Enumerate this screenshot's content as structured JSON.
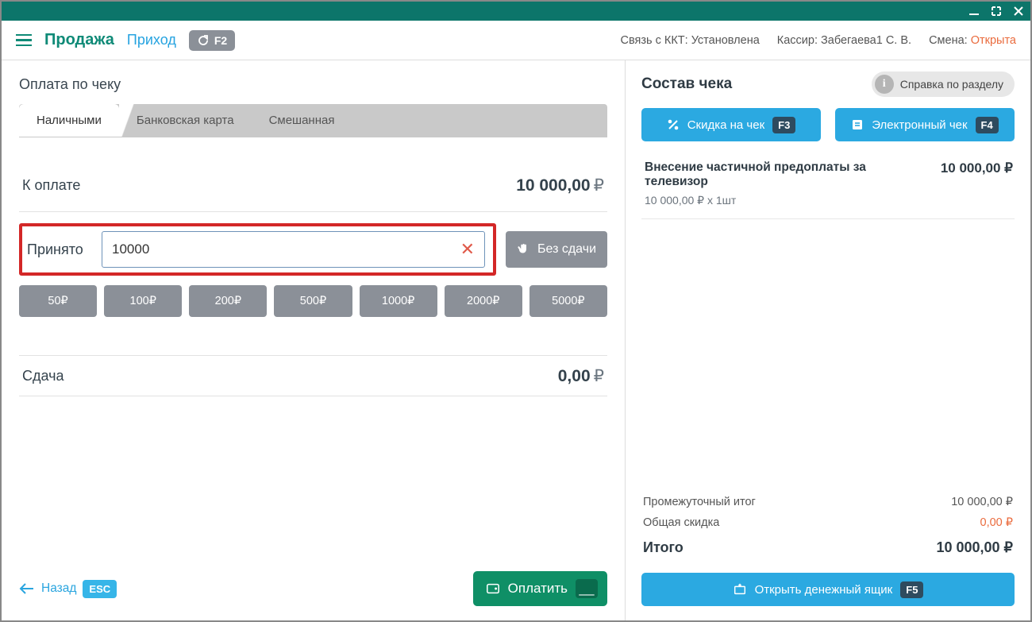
{
  "titlebar": {},
  "topbar": {
    "title_main": "Продажа",
    "title_sub": "Приход",
    "refresh_kbd": "F2",
    "kkt_label": "Связь с ККТ:",
    "kkt_status": "Установлена",
    "cashier_label": "Кассир:",
    "cashier_name": "Забегаева1 С. В.",
    "shift_label": "Смена:",
    "shift_status": "Открыта"
  },
  "left": {
    "section_title": "Оплата по чеку",
    "tabs": [
      "Наличными",
      "Банковская карта",
      "Смешанная"
    ],
    "active_tab": 0,
    "to_pay_label": "К оплате",
    "to_pay_value": "10 000,00",
    "currency": "₽",
    "accepted_label": "Принято",
    "accepted_value": "10000",
    "no_change_label": "Без  сдачи",
    "presets": [
      "50₽",
      "100₽",
      "200₽",
      "500₽",
      "1000₽",
      "2000₽",
      "5000₽"
    ],
    "change_label": "Сдача",
    "change_value": "0,00",
    "back_label": "Назад",
    "back_kbd": "ESC",
    "pay_label": "Оплатить",
    "pay_kbd": "__"
  },
  "right": {
    "title": "Состав чека",
    "help_label": "Справка по разделу",
    "discount_btn": "Скидка на чек",
    "discount_kbd": "F3",
    "echeck_btn": "Электронный чек",
    "echeck_kbd": "F4",
    "item": {
      "name": "Внесение частичной предоплаты за телевизор",
      "detail": "10 000,00 ₽ х 1шт",
      "price": "10 000,00 ₽"
    },
    "subtotal_label": "Промежуточный итог",
    "subtotal_value": "10 000,00 ₽",
    "discount_label": "Общая скидка",
    "discount_value": "0,00 ₽",
    "total_label": "Итого",
    "total_value": "10 000,00 ₽",
    "drawer_label": "Открыть денежный ящик",
    "drawer_kbd": "F5"
  }
}
